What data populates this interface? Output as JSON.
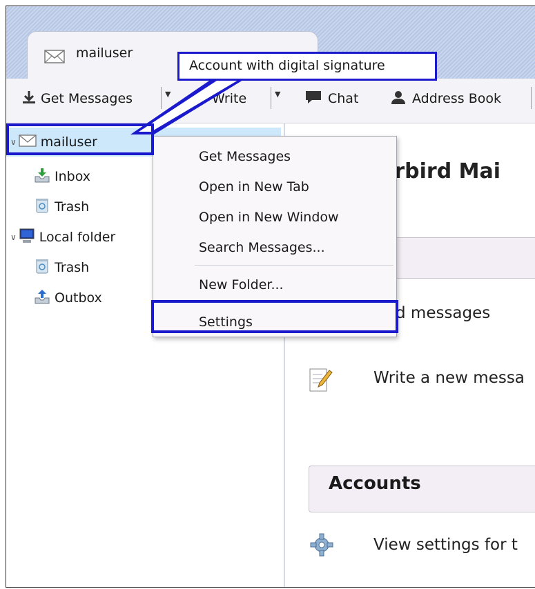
{
  "tab": {
    "label": "mailuser"
  },
  "toolbar": {
    "get_messages": "Get Messages",
    "write": "Write",
    "chat": "Chat",
    "address_book": "Address Book"
  },
  "sidebar": {
    "account": "mailuser",
    "inbox": "Inbox",
    "trash": "Trash",
    "local_folder": "Local folder",
    "local_trash": "Trash",
    "outbox": "Outbox"
  },
  "context_menu": {
    "get_messages": "Get Messages",
    "open_new_tab": "Open in New Tab",
    "open_new_window": "Open in New Window",
    "search_messages": "Search Messages...",
    "new_folder": "New Folder...",
    "settings": "Settings"
  },
  "main": {
    "title_fragment": "erbird Mai",
    "read_fragment": "d messages",
    "write_text": "Write a new messa",
    "accounts_heading": "Accounts",
    "view_settings_text": "View settings for t"
  },
  "annotation": {
    "callout": "Account with digital signature",
    "color": "#1a1acc"
  },
  "icons": [
    "mail-icon",
    "download-icon",
    "pencil-icon",
    "chat-icon",
    "person-icon",
    "inbox-icon",
    "trash-icon",
    "computer-icon",
    "outbox-icon",
    "notepad-icon",
    "gear-icon"
  ]
}
